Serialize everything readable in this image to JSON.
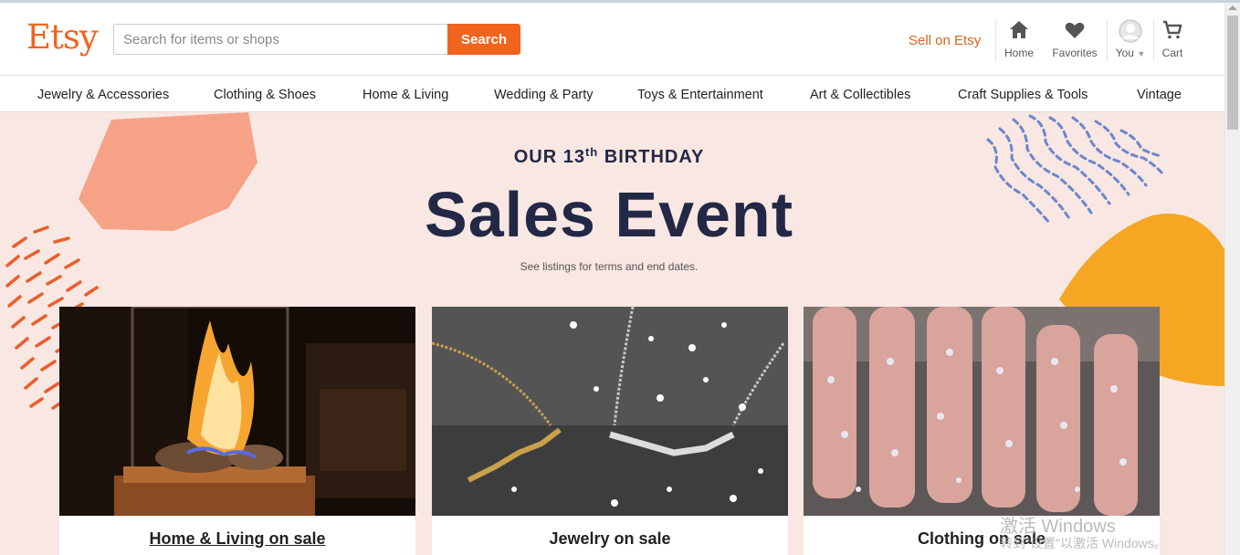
{
  "brand": {
    "logo": "Etsy",
    "accent": "#f1641e"
  },
  "search": {
    "placeholder": "Search for items or shops",
    "button_label": "Search"
  },
  "header": {
    "sell_label": "Sell on Etsy",
    "nav": [
      {
        "label": "Home",
        "icon": "home-icon"
      },
      {
        "label": "Favorites",
        "icon": "heart-icon"
      },
      {
        "label": "You",
        "icon": "avatar"
      },
      {
        "label": "Cart",
        "icon": "cart-icon"
      }
    ]
  },
  "categories": [
    "Jewelry & Accessories",
    "Clothing & Shoes",
    "Home & Living",
    "Wedding & Party",
    "Toys & Entertainment",
    "Art & Collectibles",
    "Craft Supplies & Tools",
    "Vintage"
  ],
  "hero": {
    "subtitle_pre": "OUR 13",
    "subtitle_sup": "th",
    "subtitle_post": "BIRTHDAY",
    "title": "Sales Event",
    "note": "See listings for terms and end dates.",
    "bg_color": "#f8e7e2"
  },
  "cards": [
    {
      "caption": "Home & Living on sale"
    },
    {
      "caption": "Jewelry on sale"
    },
    {
      "caption": "Clothing on sale"
    }
  ],
  "watermark": {
    "line1": "激活 Windows",
    "line2": "转到\"设置\"以激活 Windows。"
  }
}
